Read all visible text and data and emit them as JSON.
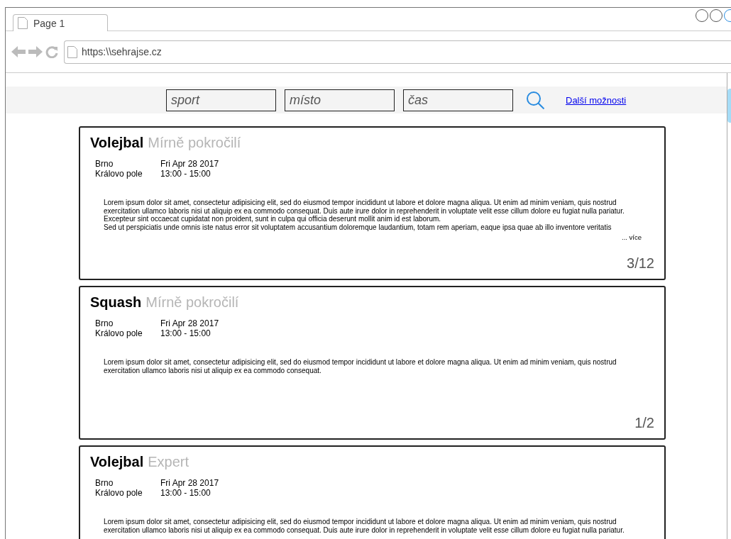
{
  "browser": {
    "tab": {
      "title": "Page 1",
      "selected": true
    },
    "url": "https:\\\\sehrajse.cz"
  },
  "search": {
    "fields": [
      {
        "placeholder": "sport"
      },
      {
        "placeholder": "místo"
      },
      {
        "placeholder": "čas"
      }
    ],
    "more_link": "Další možnosti"
  },
  "events": [
    {
      "sport": "Volejbal",
      "level": "Mírně pokročilí",
      "city": "Brno",
      "place": "Královo pole",
      "date": "Fri Apr 28 2017",
      "time": "13:00 - 15:00",
      "description": "Lorem ipsum dolor sit amet, consectetur adipisicing elit, sed do eiusmod tempor incididunt ut labore et dolore magna aliqua. Ut enim ad minim veniam, quis nostrud exercitation ullamco laboris nisi ut aliquip ex ea commodo consequat. Duis aute irure dolor in reprehenderit in voluptate velit esse cillum dolore eu fugiat nulla pariatur. Excepteur sint occaecat cupidatat non proident, sunt in culpa qui officia deserunt mollit anim id est laborum.\nSed ut perspiciatis unde omnis iste natus error sit voluptatem accusantium doloremque laudantium, totam rem aperiam, eaque ipsa quae ab illo inventore veritatis",
      "more": "... více",
      "count": "3/12"
    },
    {
      "sport": "Squash",
      "level": "Mírně pokročilí",
      "city": "Brno",
      "place": "Královo pole",
      "date": "Fri Apr 28 2017",
      "time": "13:00 - 15:00",
      "description": "Lorem ipsum dolor sit amet, consectetur adipisicing elit, sed do eiusmod tempor incididunt ut labore et dolore magna aliqua. Ut enim ad minim veniam, quis nostrud exercitation ullamco laboris nisi ut aliquip ex ea commodo consequat.",
      "count": "1/2"
    },
    {
      "sport": "Volejbal",
      "level": "Expert",
      "city": "Brno",
      "place": "Královo pole",
      "date": "Fri Apr 28 2017",
      "time": "13:00 - 15:00",
      "description": "Lorem ipsum dolor sit amet, consectetur adipisicing elit, sed do eiusmod tempor incididunt ut labore et dolore magna aliqua. Ut enim ad minim veniam, quis nostrud exercitation ullamco laboris nisi ut aliquip ex ea commodo consequat. Duis aute irure dolor in reprehenderit in voluptate velit esse cillum dolore eu fugiat nulla pariatur."
    }
  ]
}
